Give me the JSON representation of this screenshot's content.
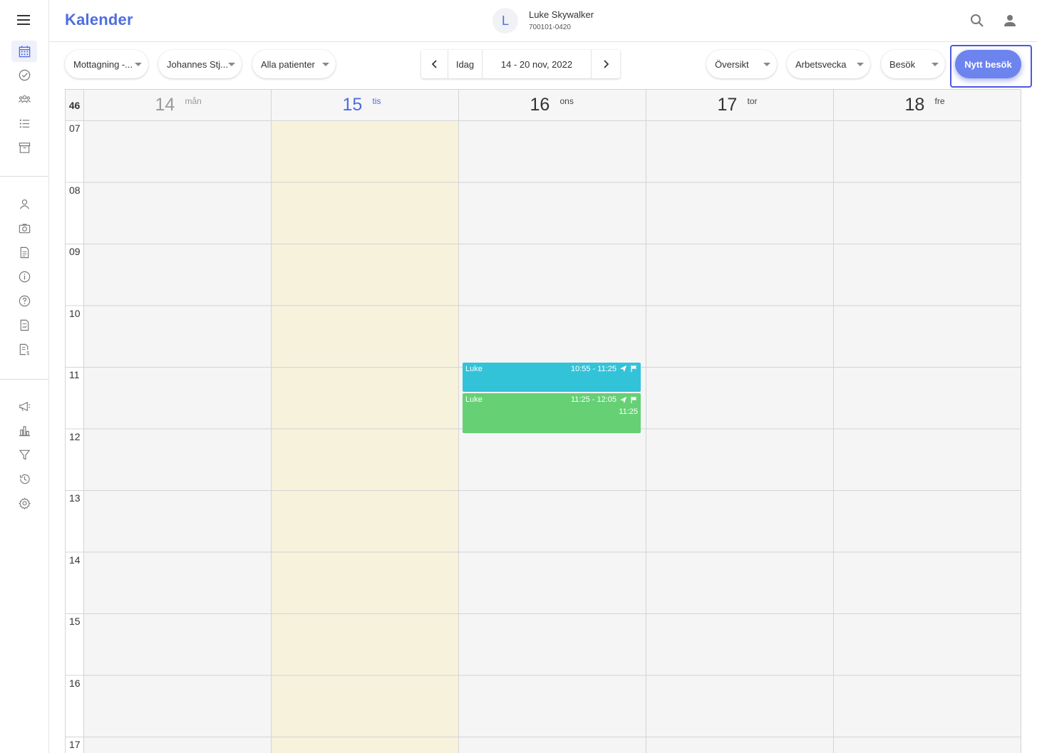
{
  "app": {
    "title": "Kalender"
  },
  "user": {
    "initial": "L",
    "name": "Luke Skywalker",
    "id": "700101-0420"
  },
  "toolbar": {
    "clinic": "Mottagning -...",
    "practitioner": "Johannes Stj...",
    "patients": "Alla patienter",
    "today": "Idag",
    "date_range": "14 - 20 nov, 2022",
    "view": "Översikt",
    "period": "Arbetsvecka",
    "type": "Besök",
    "new_visit": "Nytt besök"
  },
  "calendar": {
    "week_number": "46",
    "days": [
      {
        "num": "14",
        "abbr": "mån",
        "state": "past"
      },
      {
        "num": "15",
        "abbr": "tis",
        "state": "today"
      },
      {
        "num": "16",
        "abbr": "ons",
        "state": "future"
      },
      {
        "num": "17",
        "abbr": "tor",
        "state": "future"
      },
      {
        "num": "18",
        "abbr": "fre",
        "state": "future"
      }
    ],
    "hours": [
      "07",
      "08",
      "09",
      "10",
      "11",
      "12",
      "13",
      "14",
      "15",
      "16",
      "17"
    ],
    "events": [
      {
        "day": "16",
        "name": "Luke",
        "time": "10:55 - 11:25",
        "sub": "",
        "color": "#33c3d9"
      },
      {
        "day": "16",
        "name": "Luke",
        "time": "11:25 - 12:05",
        "sub": "11:25",
        "color": "#66d075"
      }
    ]
  },
  "colors": {
    "accent": "#4f6de0",
    "button": "#6d84ee",
    "today_bg": "#f6f2dc"
  }
}
